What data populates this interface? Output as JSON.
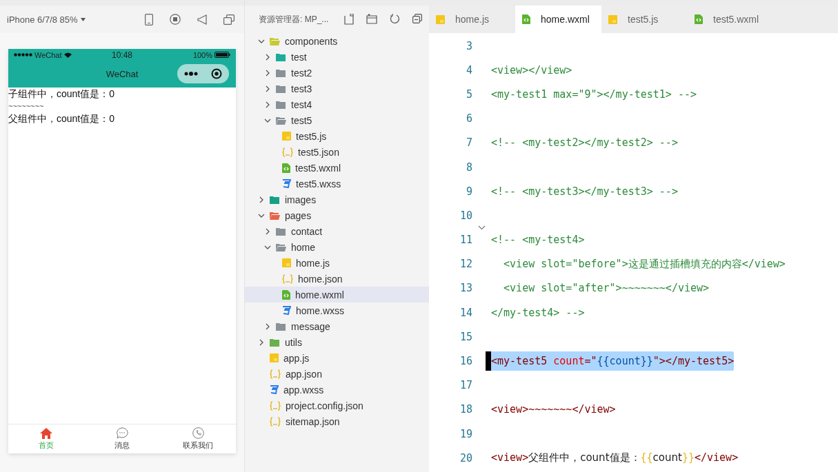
{
  "simulator": {
    "device": "iPhone 6/7/8 85%",
    "status_bar": {
      "carrier": "WeChat",
      "time": "10:48",
      "battery": "100%"
    },
    "nav_title": "WeChat",
    "content": [
      "子组件中，count值是：0",
      "~~~~~~~~",
      "父组件中，count值是：0"
    ],
    "tab_bar": [
      {
        "label": "首页",
        "selected": true
      },
      {
        "label": "消息",
        "selected": false
      },
      {
        "label": "联系我们",
        "selected": false
      }
    ]
  },
  "explorer": {
    "title": "资源管理器: MP_...",
    "tree": [
      {
        "label": "components",
        "kind": "folder",
        "color": "#c8c832",
        "expanded": true,
        "selected": false,
        "children": [
          {
            "label": "test",
            "kind": "folder",
            "color": "#1aad9b",
            "expanded": false,
            "selected": false
          },
          {
            "label": "test2",
            "kind": "folder",
            "color": "#8a9199",
            "expanded": false,
            "selected": false
          },
          {
            "label": "test3",
            "kind": "folder",
            "color": "#8a9199",
            "expanded": false,
            "selected": false
          },
          {
            "label": "test4",
            "kind": "folder",
            "color": "#8a9199",
            "expanded": false,
            "selected": false
          },
          {
            "label": "test5",
            "kind": "folder",
            "color": "#8a9199",
            "expanded": true,
            "selected": false,
            "children": [
              {
                "label": "test5.js",
                "kind": "js",
                "selected": false
              },
              {
                "label": "test5.json",
                "kind": "json",
                "selected": false
              },
              {
                "label": "test5.wxml",
                "kind": "wxml",
                "selected": false
              },
              {
                "label": "test5.wxss",
                "kind": "wxss",
                "selected": false
              }
            ]
          }
        ]
      },
      {
        "label": "images",
        "kind": "folder",
        "color": "#16a085",
        "expanded": false,
        "selected": false
      },
      {
        "label": "pages",
        "kind": "folder",
        "color": "#e8624a",
        "expanded": true,
        "selected": false,
        "children": [
          {
            "label": "contact",
            "kind": "folder",
            "color": "#8a9199",
            "expanded": false,
            "selected": false
          },
          {
            "label": "home",
            "kind": "folder",
            "color": "#8a9199",
            "expanded": true,
            "selected": false,
            "children": [
              {
                "label": "home.js",
                "kind": "js",
                "selected": false
              },
              {
                "label": "home.json",
                "kind": "json",
                "selected": false
              },
              {
                "label": "home.wxml",
                "kind": "wxml",
                "selected": true
              },
              {
                "label": "home.wxss",
                "kind": "wxss",
                "selected": false
              }
            ]
          },
          {
            "label": "message",
            "kind": "folder",
            "color": "#8a9199",
            "expanded": false,
            "selected": false
          }
        ]
      },
      {
        "label": "utils",
        "kind": "folder",
        "color": "#6ab04c",
        "expanded": false,
        "selected": false
      },
      {
        "label": "app.js",
        "kind": "js",
        "selected": false
      },
      {
        "label": "app.json",
        "kind": "json",
        "selected": false
      },
      {
        "label": "app.wxss",
        "kind": "wxss",
        "selected": false
      },
      {
        "label": "project.config.json",
        "kind": "json",
        "selected": false
      },
      {
        "label": "sitemap.json",
        "kind": "json",
        "selected": false
      }
    ]
  },
  "editor": {
    "tabs": [
      {
        "label": "home.js",
        "kind": "js",
        "selected": false
      },
      {
        "label": "home.wxml",
        "kind": "wxml",
        "selected": true
      },
      {
        "label": "test5.js",
        "kind": "js",
        "selected": false
      },
      {
        "label": "test5.wxml",
        "kind": "wxml",
        "selected": false
      }
    ],
    "lines": [
      {
        "number": "3",
        "selected": false,
        "foldable": false
      },
      {
        "number": "4",
        "selected": false,
        "foldable": false,
        "segments": [
          {
            "text": "<view></view>",
            "kind": "comment"
          }
        ]
      },
      {
        "number": "5",
        "selected": false,
        "foldable": false,
        "segments": [
          {
            "text": "<my-test1 max=\"9\"></my-test1> -->",
            "kind": "comment"
          }
        ]
      },
      {
        "number": "6",
        "selected": false,
        "foldable": false
      },
      {
        "number": "7",
        "selected": false,
        "foldable": false,
        "segments": [
          {
            "text": "<!-- <my-test2></my-test2> -->",
            "kind": "comment"
          }
        ]
      },
      {
        "number": "8",
        "selected": false,
        "foldable": false
      },
      {
        "number": "9",
        "selected": false,
        "foldable": false,
        "segments": [
          {
            "text": "<!-- <my-test3></my-test3> -->",
            "kind": "comment"
          }
        ]
      },
      {
        "number": "10",
        "selected": false,
        "foldable": false
      },
      {
        "number": "11",
        "selected": false,
        "foldable": true,
        "segments": [
          {
            "text": "<!-- <my-test4>",
            "kind": "comment"
          }
        ]
      },
      {
        "number": "12",
        "selected": false,
        "foldable": false,
        "segments": [
          {
            "text": "  <view slot=\"before\">这是通过插槽填充的内容</view>",
            "kind": "comment"
          }
        ]
      },
      {
        "number": "13",
        "selected": false,
        "foldable": false,
        "segments": [
          {
            "text": "  <view slot=\"after\">~~~~~~~</view>",
            "kind": "comment"
          }
        ]
      },
      {
        "number": "14",
        "selected": false,
        "foldable": false,
        "segments": [
          {
            "text": "</my-test4> -->",
            "kind": "comment"
          }
        ]
      },
      {
        "number": "15",
        "selected": false,
        "foldable": false
      },
      {
        "number": "16",
        "selected": true,
        "foldable": false,
        "segments": [
          {
            "text": "<my-test5 ",
            "kind": "tag"
          },
          {
            "text": "count",
            "kind": "attr"
          },
          {
            "text": "=\"",
            "kind": "tag"
          },
          {
            "text": "{{count}}",
            "kind": "string"
          },
          {
            "text": "\"></my-test5>",
            "kind": "tag"
          }
        ]
      },
      {
        "number": "17",
        "selected": false,
        "foldable": false
      },
      {
        "number": "18",
        "selected": false,
        "foldable": false,
        "segments": [
          {
            "text": "<view>~~~~~~~</view>",
            "kind": "tag"
          }
        ]
      },
      {
        "number": "19",
        "selected": false,
        "foldable": false
      },
      {
        "number": "20",
        "selected": false,
        "foldable": false,
        "segments": [
          {
            "text": "<view>",
            "kind": "tag"
          },
          {
            "text": "父组件中，count值是：",
            "kind": "text"
          },
          {
            "text": "{{",
            "kind": "brace"
          },
          {
            "text": "count",
            "kind": "text"
          },
          {
            "text": "}}",
            "kind": "brace"
          },
          {
            "text": "</view>",
            "kind": "tag"
          }
        ]
      }
    ]
  }
}
